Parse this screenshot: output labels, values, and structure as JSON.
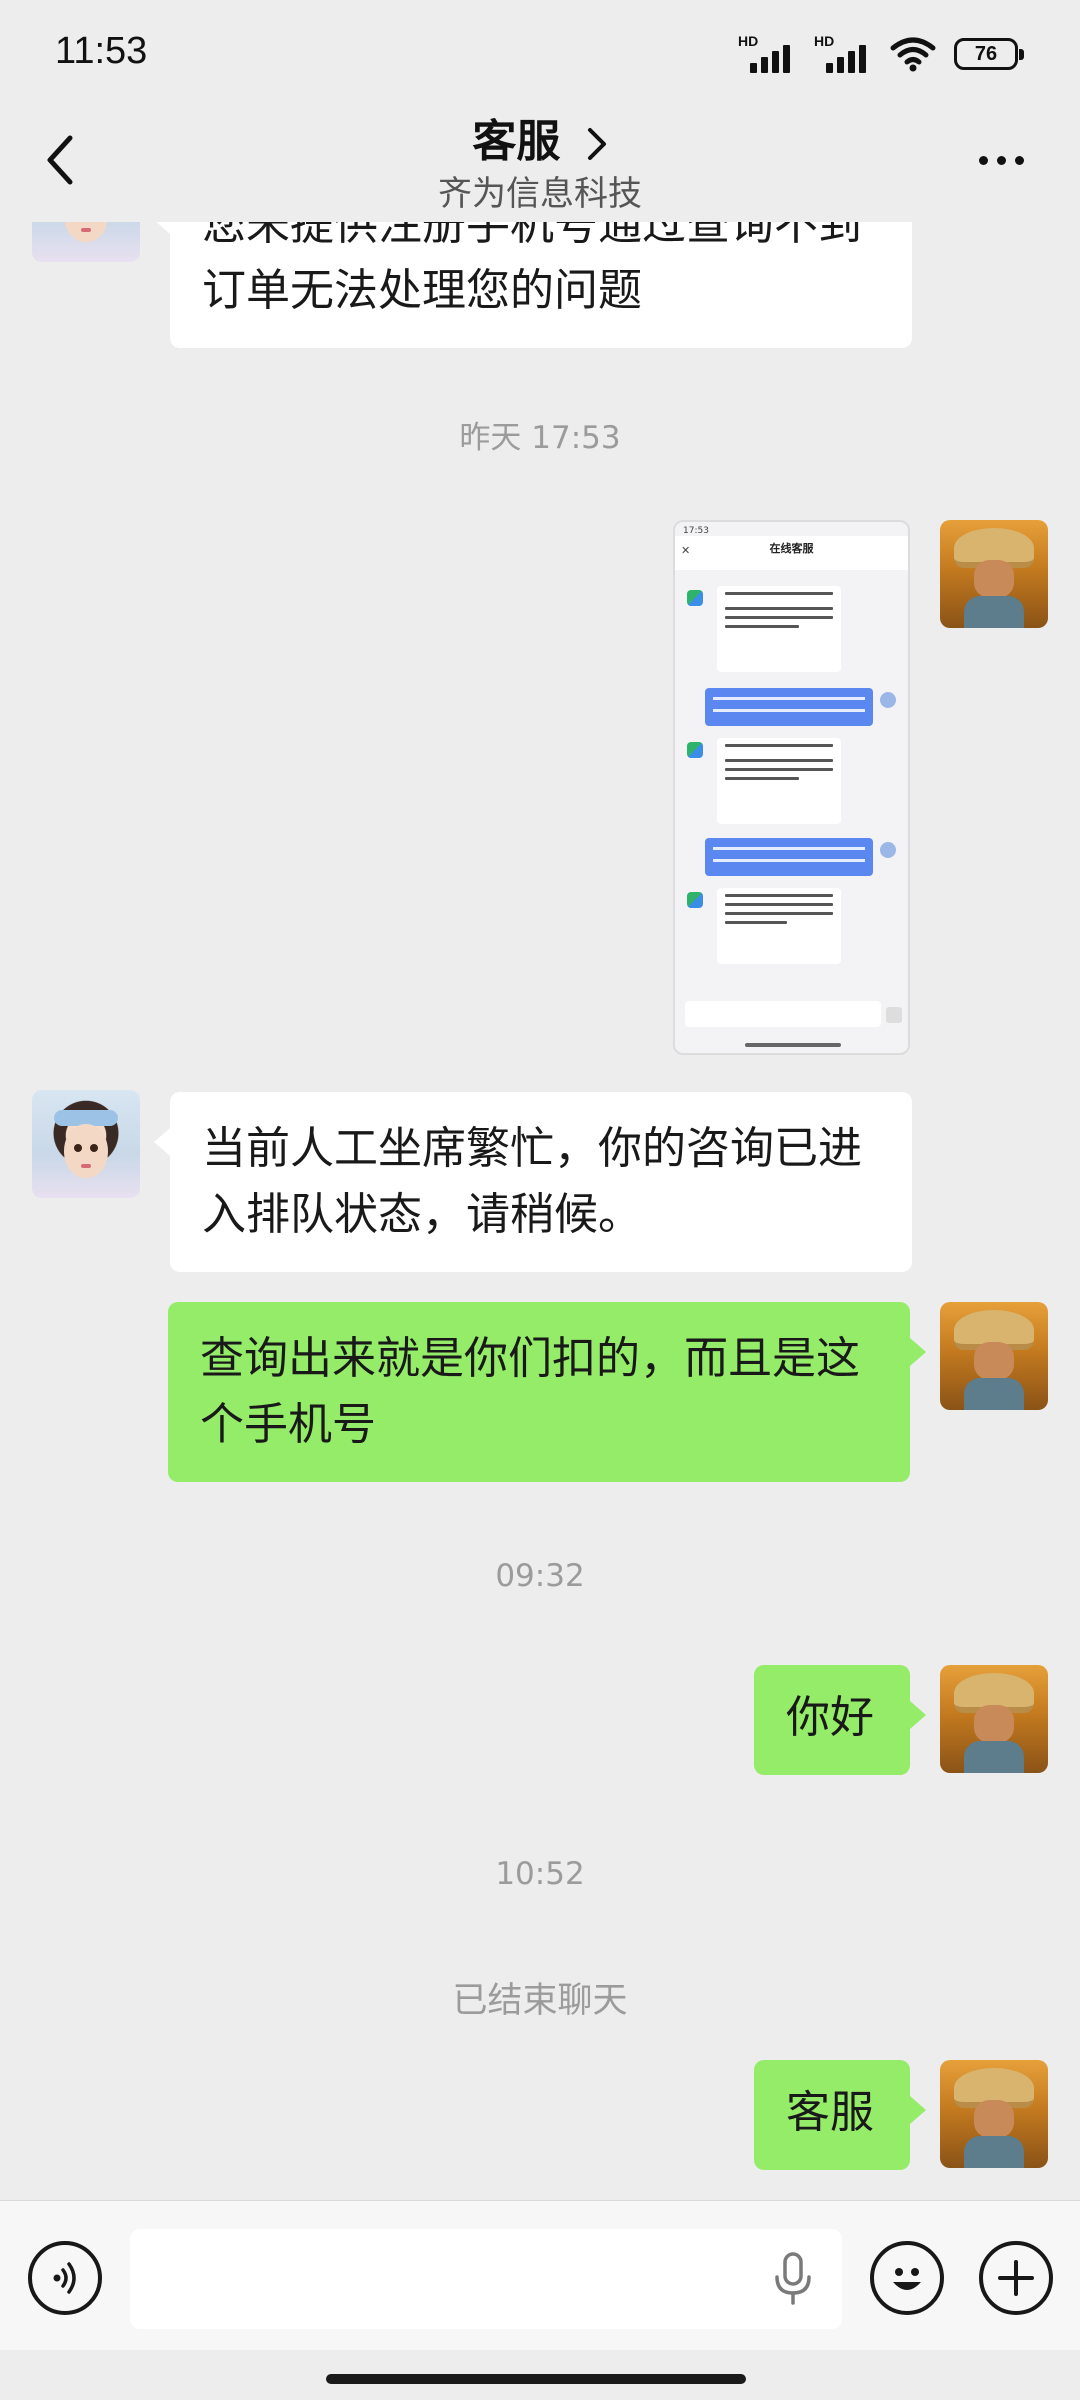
{
  "status_bar": {
    "time": "11:53",
    "signal_1_label": "HD",
    "signal_2_label": "HD",
    "battery": "76",
    "icons": [
      "signal-icon",
      "signal-icon",
      "wifi-icon",
      "battery-icon"
    ]
  },
  "header": {
    "title": "客服",
    "subtitle": "齐为信息科技",
    "icons": [
      "back-icon",
      "chevron-right-icon",
      "more-icon"
    ]
  },
  "messages": {
    "m1_line1": "您未提供注册手机号通过查询不到",
    "m1_line2": "订单无法处理您的问题",
    "ts1": "昨天 17:53",
    "screenshot_title": "在线客服",
    "m2_line1": "当前人工坐席繁忙，你的咨询已进",
    "m2_line2": "入排队状态，请稍候。",
    "m3_line1": "查询出来就是你们扣的，而且是这",
    "m3_line2": "个手机号",
    "ts2": "09:32",
    "m4": "你好",
    "ts3": "10:52",
    "system_note": "已结束聊天",
    "m5": "客服"
  },
  "input_bar": {
    "placeholder": "",
    "icons": [
      "voice-icon",
      "mic-icon",
      "emoji-icon",
      "plus-icon"
    ]
  },
  "colors": {
    "background": "#ededed",
    "bubble_sent": "#95ec69",
    "bubble_received": "#ffffff"
  }
}
